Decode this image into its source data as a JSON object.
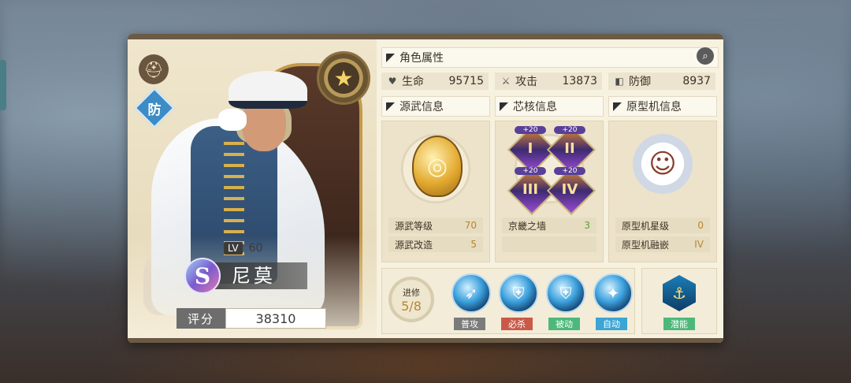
{
  "character": {
    "name": "尼莫",
    "level_tag": "LV",
    "level": "60",
    "rank": "S",
    "role": "防",
    "score_label": "评分",
    "score": "38310"
  },
  "attributes": {
    "header": "角色属性",
    "stats": [
      {
        "label": "生命",
        "value": "95715",
        "icon": "heart-icon"
      },
      {
        "label": "攻击",
        "value": "13873",
        "icon": "sword-icon"
      },
      {
        "label": "防御",
        "value": "8937",
        "icon": "shield-icon"
      }
    ]
  },
  "source_weapon": {
    "header": "源武信息",
    "rows": [
      {
        "label": "源武等级",
        "value": "70"
      },
      {
        "label": "源武改造",
        "value": "5"
      }
    ]
  },
  "core": {
    "header": "芯核信息",
    "items": [
      {
        "level": "+20",
        "numeral": "I"
      },
      {
        "level": "+20",
        "numeral": "II"
      },
      {
        "level": "+20",
        "numeral": "III"
      },
      {
        "level": "+20",
        "numeral": "IV"
      }
    ],
    "row": {
      "label": "京畿之墙",
      "value": "3"
    }
  },
  "prototype": {
    "header": "原型机信息",
    "rows": [
      {
        "label": "原型机星级",
        "value": "0"
      },
      {
        "label": "原型机融嵌",
        "value": "IV"
      }
    ]
  },
  "advance": {
    "label": "进修",
    "value": "5/8"
  },
  "skills": [
    {
      "label": "普攻",
      "color": "#7b7b7b"
    },
    {
      "label": "必杀",
      "color": "#c95a48"
    },
    {
      "label": "被动",
      "color": "#4db87a"
    },
    {
      "label": "自动",
      "color": "#3ba5d4"
    }
  ],
  "potential": {
    "label": "潜能",
    "color": "#4db87a"
  }
}
